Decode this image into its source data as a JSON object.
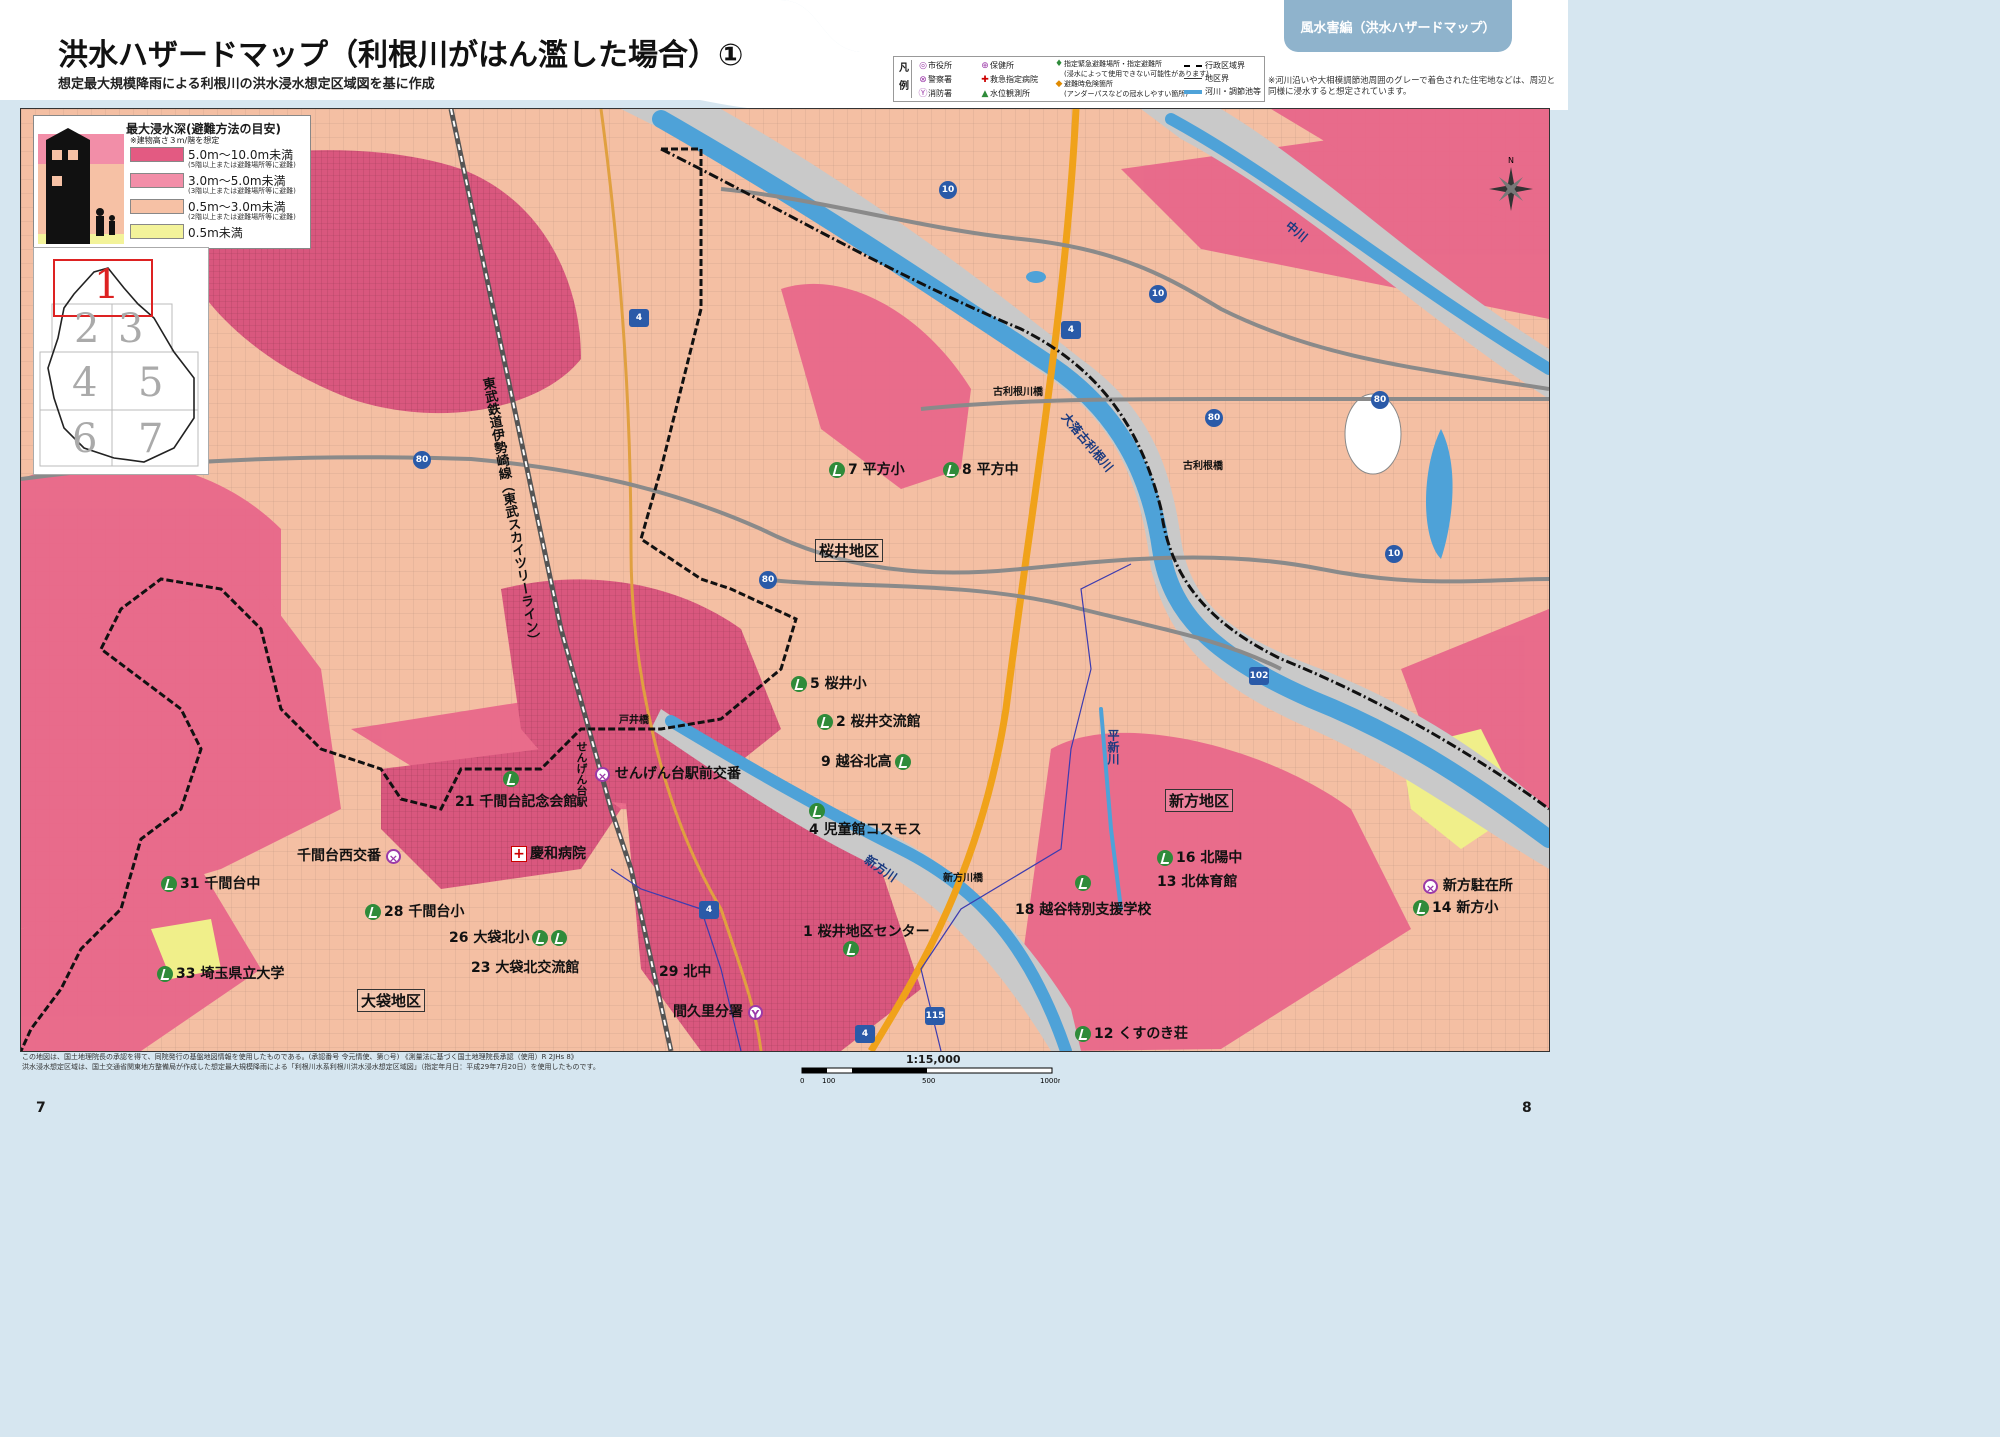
{
  "header": {
    "tab_label": "風水害編（洪水ハザードマップ）",
    "title": "洪水ハザードマップ（利根川がはん濫した場合）①",
    "subtitle": "想定最大規模降雨による利根川の洪水浸水想定区域図を基に作成"
  },
  "top_legend": {
    "heading": "凡例",
    "col1": [
      "市役所",
      "警察署",
      "消防署"
    ],
    "col2": [
      "保健所",
      "救急指定病院",
      "水位観測所"
    ],
    "col3": [
      "指定緊急避難場所・指定避難所",
      "(浸水によって使用できない可能性があります)",
      "避難時危険箇所",
      "(アンダーパスなどの冠水しやすい箇所)"
    ],
    "col4": [
      "行政区域界",
      "地区界",
      "河川・調節池等"
    ],
    "note": "※河川沿いや大相模調節池周囲のグレーで着色された住宅地などは、周辺と同様に浸水すると想定されています。"
  },
  "depth_legend": {
    "title": "最大浸水深(避難方法の目安)",
    "note": "※建物高さ３m/階を想定",
    "items": [
      {
        "label": "5.0m～10.0m未満",
        "sub": "(5階以上または避難場所等に避難)",
        "color": "#e35a82"
      },
      {
        "label": "3.0m～5.0m未満",
        "sub": "(3階以上または避難場所等に避難)",
        "color": "#f28ea8"
      },
      {
        "label": "0.5m～3.0m未満",
        "sub": "(2階以上または避難場所等に避難)",
        "color": "#f6c1a5"
      },
      {
        "label": "0.5m未満",
        "sub": "",
        "color": "#f3f39a"
      }
    ]
  },
  "index_map": {
    "cells": [
      "1",
      "2",
      "3",
      "4",
      "5",
      "6",
      "7"
    ],
    "active": "1"
  },
  "map": {
    "districts": [
      "桜井地区",
      "新方地区",
      "大袋地区"
    ],
    "rivers": [
      "大落古利根川",
      "中川",
      "新方川",
      "平新川"
    ],
    "railway": "東武鉄道伊勢崎線（東武スカイツリーライン）",
    "station": "せんげん台駅",
    "bridges": [
      "古利根川橋",
      "古利根橋",
      "戸井橋",
      "新方川橋"
    ],
    "routes": [
      "10",
      "10",
      "10",
      "4",
      "4",
      "4",
      "4",
      "80",
      "80",
      "80",
      "80",
      "102",
      "115"
    ],
    "shelters": [
      "7 平方小",
      "8 平方中",
      "5 桜井小",
      "2 桜井交流館",
      "9 越谷北高",
      "4 児童館コスモス",
      "21 千間台記念会館",
      "31 千間台中",
      "28 千間台小",
      "26 大袋北小",
      "23 大袋北交流館",
      "33 埼玉県立大学",
      "29 北中",
      "1 桜井地区センター",
      "16 北陽中",
      "13 北体育館",
      "18 越谷特別支援学校",
      "14 新方小",
      "12 くすのき荘"
    ],
    "police": [
      "せんげん台駅前交番",
      "千間台西交番",
      "間久里分署",
      "新方駐在所"
    ],
    "hospital": "慶和病院"
  },
  "footer": {
    "note1": "この地図は、国土地理院長の承認を得て、同院発行の基盤地図情報を使用したものである。(承認番号 令元情使、第○号) 《測量法に基づく国土地理院長承認（使用）R 2JHs 8》",
    "note2": "洪水浸水想定区域は、国土交通省関東地方整備局が作成した想定最大規模降雨による「利根川水系利根川洪水浸水想定区域図」（指定年月日：平成29年7月20日）を使用したものです。",
    "scale": "1:15,000",
    "scale_ticks": [
      "0",
      "100",
      "500",
      "1000m"
    ]
  },
  "pages": {
    "left": "7",
    "right": "8"
  }
}
